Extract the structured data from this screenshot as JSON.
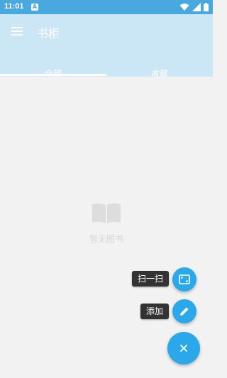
{
  "status_bar": {
    "time": "11:01",
    "app_icon_letter": "A",
    "icons": [
      "wifi-icon",
      "signal-icon",
      "battery-icon"
    ]
  },
  "app_bar": {
    "title": "书柜"
  },
  "tabs": [
    {
      "label": "全部",
      "selected": true
    },
    {
      "label": "收藏",
      "selected": false
    }
  ],
  "empty_state": {
    "icon": "book-icon",
    "message": "暂无图书"
  },
  "fab_menu": {
    "scan_label": "扫一扫",
    "add_label": "添加",
    "scan_icon": "scan-frame-icon",
    "add_icon": "pencil-icon",
    "close_icon": "close-icon"
  },
  "colors": {
    "status_bar": "#49a8dd",
    "app_bar": "#cbe6f4",
    "fab": "#2aa8ea",
    "background": "#f2f2f2",
    "tooltip": "#333333"
  }
}
